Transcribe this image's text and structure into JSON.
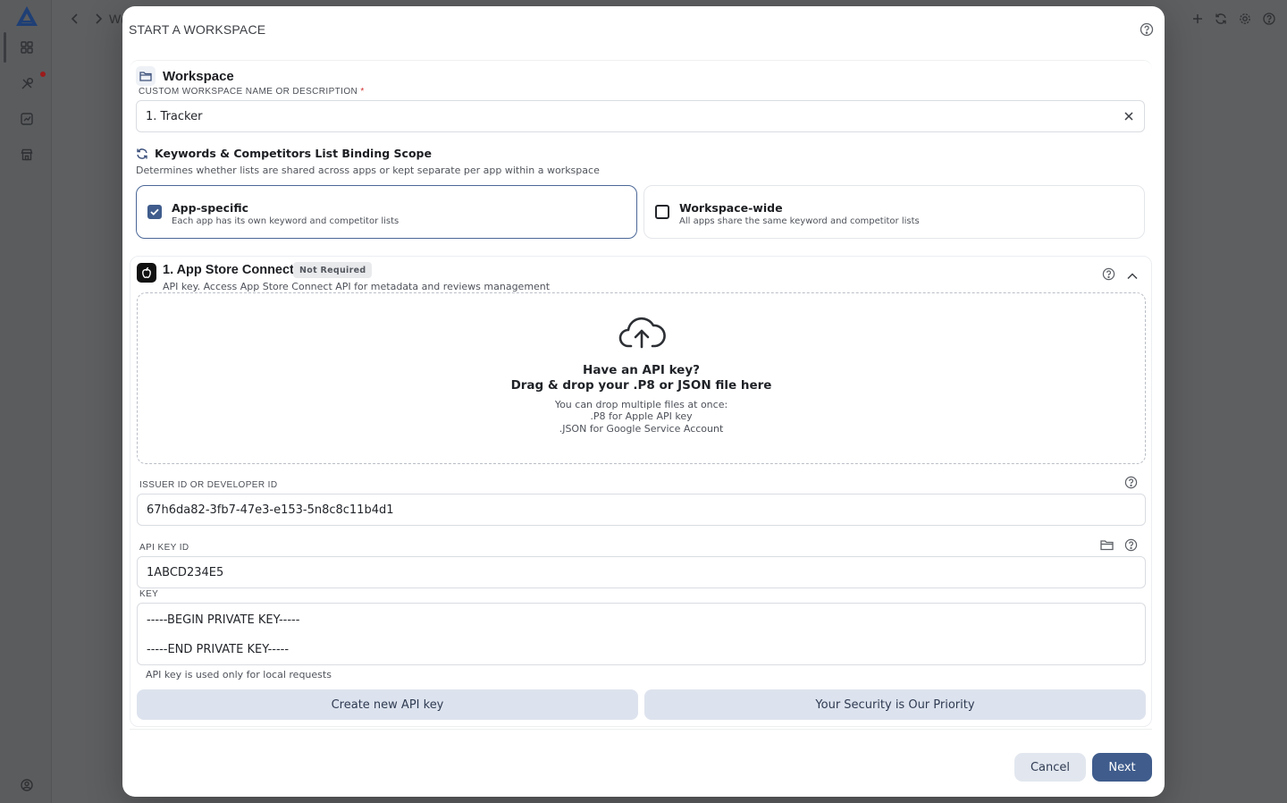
{
  "background": {
    "breadcrumb_fragment": "W(",
    "sidebar_icons": [
      "dashboard-icon",
      "tools-icon",
      "chart-icon",
      "store-icon",
      "account-icon"
    ],
    "topbar_icons": [
      "plus-icon",
      "refresh-icon",
      "gear-icon",
      "help-icon"
    ]
  },
  "modal": {
    "title": "START A WORKSPACE",
    "workspace": {
      "heading": "Workspace",
      "name_label": "CUSTOM WORKSPACE NAME OR DESCRIPTION",
      "required_mark": "*",
      "name_value": "1. Tracker"
    },
    "scope": {
      "heading": "Keywords & Competitors List Binding Scope",
      "description": "Determines whether lists are shared across apps or kept separate per app within a workspace",
      "options": [
        {
          "title": "App-specific",
          "desc": "Each app has its own keyword and competitor lists",
          "checked": true
        },
        {
          "title": "Workspace-wide",
          "desc": "All apps share the same keyword and competitor lists",
          "checked": false
        }
      ]
    },
    "app_store": {
      "title": "1. App Store Connect",
      "badge": "Not Required",
      "subtitle": "API key. Access App Store Connect API for metadata and reviews management",
      "dropzone": {
        "line1": "Have an API key?",
        "line2": "Drag & drop your .P8 or JSON file here",
        "line3": "You can drop multiple files at once:",
        "line4": ".P8 for Apple API key",
        "line5": ".JSON for Google Service Account"
      },
      "issuer_label": "ISSUER ID OR DEVELOPER ID",
      "issuer_value": "67h6da82-3fb7-47e3-e153-5n8c8c11b4d1",
      "key_id_label": "API KEY ID",
      "key_id_value": "1ABCD234E5",
      "key_label": "KEY",
      "key_line1": "-----BEGIN PRIVATE KEY-----",
      "key_line2": "-----END PRIVATE KEY-----",
      "note": "API key is used only for local requests",
      "create_button": "Create new API key",
      "security_button": "Your Security is Our Priority"
    },
    "cancel_label": "Cancel",
    "next_label": "Next"
  },
  "colors": {
    "accent": "#3f5c8c",
    "overlay": "#5e5f61",
    "secondary_button": "#dde3ee",
    "required": "#d32f2f"
  }
}
